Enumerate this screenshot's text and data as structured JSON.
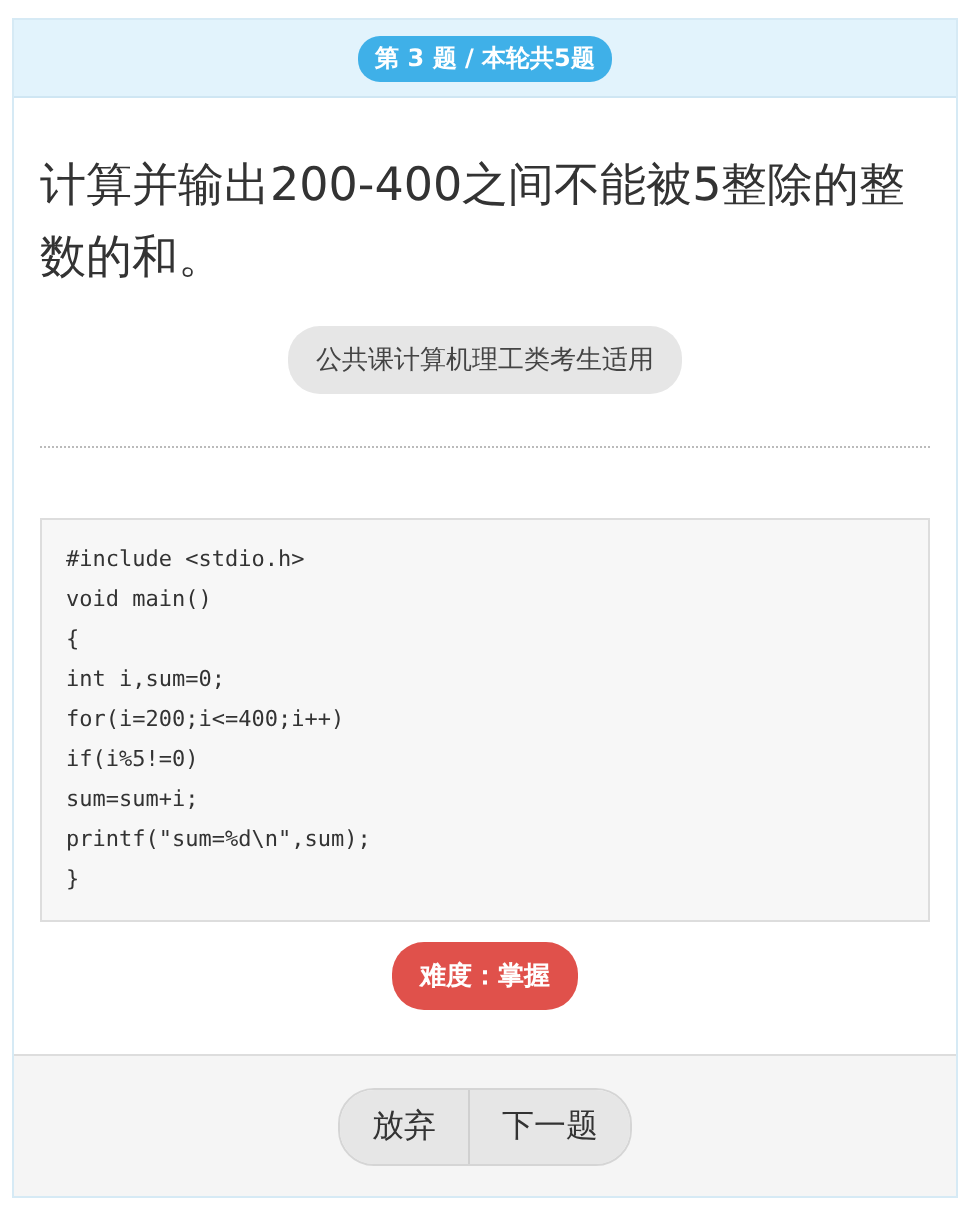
{
  "header": {
    "progress": "第 3 题 / 本轮共5题"
  },
  "question": {
    "text": "计算并输出200-400之间不能被5整除的整数的和。",
    "tag": "公共课计算机理工类考生适用",
    "code": [
      "#include <stdio.h>",
      "void main()",
      "{",
      "int i,sum=0;",
      "for(i=200;i<=400;i++)",
      "if(i%5!=0)",
      "sum=sum+i;",
      "printf(\"sum=%d\\n\",sum);",
      "}"
    ],
    "difficulty": "难度：掌握"
  },
  "buttons": [
    "放弃",
    "下一题"
  ]
}
